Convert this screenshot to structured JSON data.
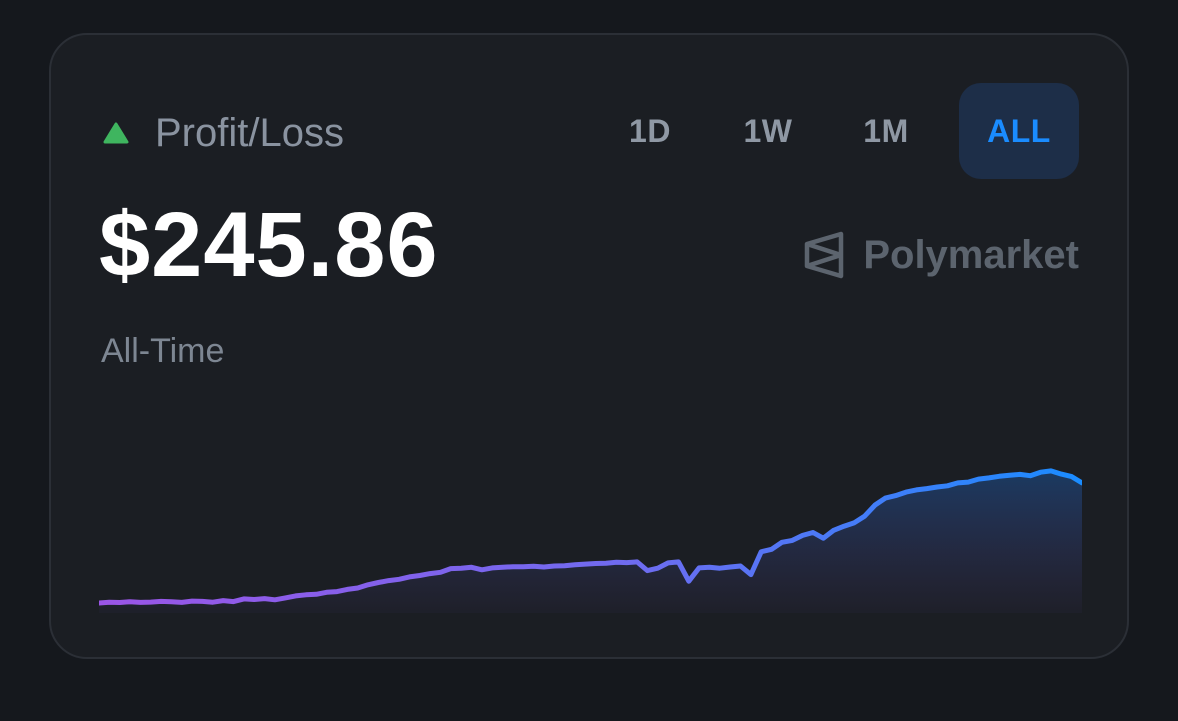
{
  "card": {
    "title": "Profit/Loss",
    "trend_icon": "triangle-up-icon",
    "amount": "$245.86",
    "period": "All-Time",
    "brand": "Polymarket",
    "brand_icon": "polymarket-logo-icon"
  },
  "tabs": [
    {
      "label": "1D",
      "active": false
    },
    {
      "label": "1W",
      "active": false
    },
    {
      "label": "1M",
      "active": false
    },
    {
      "label": "ALL",
      "active": true
    }
  ],
  "colors": {
    "positive": "#3fb55f",
    "active_tab": "#1a8cff",
    "line_start": "#9b55e6",
    "line_end": "#1a8cff"
  },
  "chart_data": {
    "type": "area",
    "values": [
      0,
      0.5,
      0.3,
      0.8,
      0.4,
      0.6,
      1.0,
      0.8,
      0.4,
      1.2,
      1.0,
      0.5,
      1.5,
      0.9,
      2.6,
      2.2,
      2.8,
      2.0,
      3.2,
      4.5,
      5.2,
      5.5,
      6.8,
      7.2,
      8.6,
      9.5,
      11.5,
      13.0,
      14.2,
      15.0,
      16.5,
      17.4,
      18.6,
      19.4,
      21.8,
      22.0,
      22.6,
      21.0,
      22.2,
      22.6,
      23.0,
      23.0,
      23.2,
      22.8,
      23.4,
      23.6,
      24.2,
      24.6,
      25.0,
      25.2,
      25.8,
      25.6,
      26.0,
      20.5,
      22.0,
      25.4,
      26.0,
      13.8,
      22.2,
      22.6,
      22.0,
      22.8,
      23.4,
      18.0,
      32.4,
      34.0,
      38.4,
      39.6,
      42.8,
      44.6,
      41.0,
      46.0,
      48.6,
      50.8,
      55.0,
      62.0,
      66.4,
      68.0,
      70.2,
      71.6,
      72.4,
      73.4,
      74.2,
      76.0,
      76.5,
      78.4,
      79.2,
      80.2,
      80.8,
      81.4,
      80.6,
      82.8,
      83.6,
      81.6,
      80.0,
      76.0
    ],
    "ylim": [
      -5,
      100
    ]
  }
}
